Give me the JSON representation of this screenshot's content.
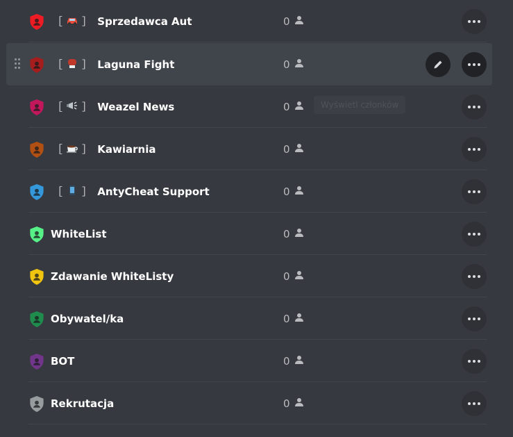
{
  "roles": [
    {
      "emoji": "car",
      "name": "Sprzedawca Aut",
      "count": "0",
      "color": "#ed1c24",
      "emoji_color": "#e74c3c"
    },
    {
      "emoji": "boxing-glove",
      "name": "Laguna Fight",
      "count": "0",
      "color": "#a51d1d",
      "emoji_color": "#c0392b"
    },
    {
      "emoji": "megaphone",
      "name": "Weazel News",
      "count": "0",
      "color": "#c2185b",
      "emoji_color": "#bdc3c7"
    },
    {
      "emoji": "coffee",
      "name": "Kawiarnia",
      "count": "0",
      "color": "#b24f13",
      "emoji_color": "#ecf0f1"
    },
    {
      "emoji": "mobile-phone",
      "name": "AntyCheat Support",
      "count": "0",
      "color": "#3498db",
      "emoji_color": "#34495e"
    },
    {
      "emoji": "",
      "name": "WhiteList",
      "count": "0",
      "color": "#57f287"
    },
    {
      "emoji": "",
      "name": "Zdawanie WhiteListy",
      "count": "0",
      "color": "#f1c40f"
    },
    {
      "emoji": "",
      "name": "Obywatel/ka",
      "count": "0",
      "color": "#1f8b4c"
    },
    {
      "emoji": "",
      "name": "BOT",
      "count": "0",
      "color": "#71368a"
    },
    {
      "emoji": "",
      "name": "Rekrutacja",
      "count": "0",
      "color": "#979c9f"
    }
  ],
  "brackets": {
    "open": "［",
    "close": "］"
  },
  "hovered_index": 1,
  "tooltip": {
    "text": "Wyświetl członków"
  },
  "icons": {
    "more": "more-dots-icon",
    "edit": "pencil-icon",
    "member": "person-icon",
    "role": "shield-icon",
    "drag": "drag-handle-icon"
  }
}
